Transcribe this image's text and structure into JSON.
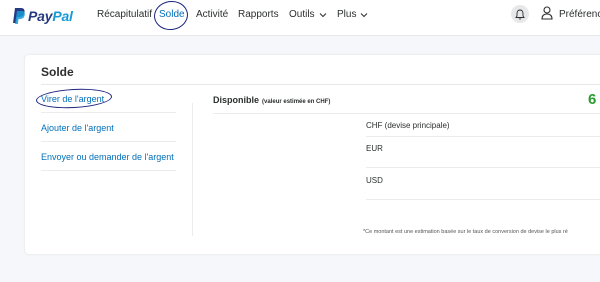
{
  "header": {
    "logo": {
      "part1": "Pay",
      "part2": "Pal"
    },
    "nav": [
      {
        "label": "Récapitulatif"
      },
      {
        "label": "Solde"
      },
      {
        "label": "Activité"
      },
      {
        "label": "Rapports"
      },
      {
        "label": "Outils"
      },
      {
        "label": "Plus"
      }
    ],
    "preferences_label": "Préférences",
    "icons": [
      "paypal-logo-icon",
      "chevron-down-icon",
      "bell-icon",
      "user-icon"
    ]
  },
  "balance_card": {
    "title": "Solde",
    "side_links": [
      "Virer de l'argent",
      "Ajouter de l'argent",
      "Envoyer ou demander de l'argent"
    ],
    "available_label": "Disponible",
    "available_note": "(valeur estimée en CHF)",
    "available_amount_partial": "6",
    "currencies": [
      "CHF (devise principale)",
      "EUR",
      "USD"
    ],
    "footnote": "*Ce montant est une estimation basée sur le taux de conversion de devise le plus ré"
  },
  "colors": {
    "brand_dark": "#253b80",
    "brand_light": "#179bd7",
    "link": "#0070ba",
    "amount_green": "#2a9c2d",
    "annotation_ink": "#1a237e"
  }
}
